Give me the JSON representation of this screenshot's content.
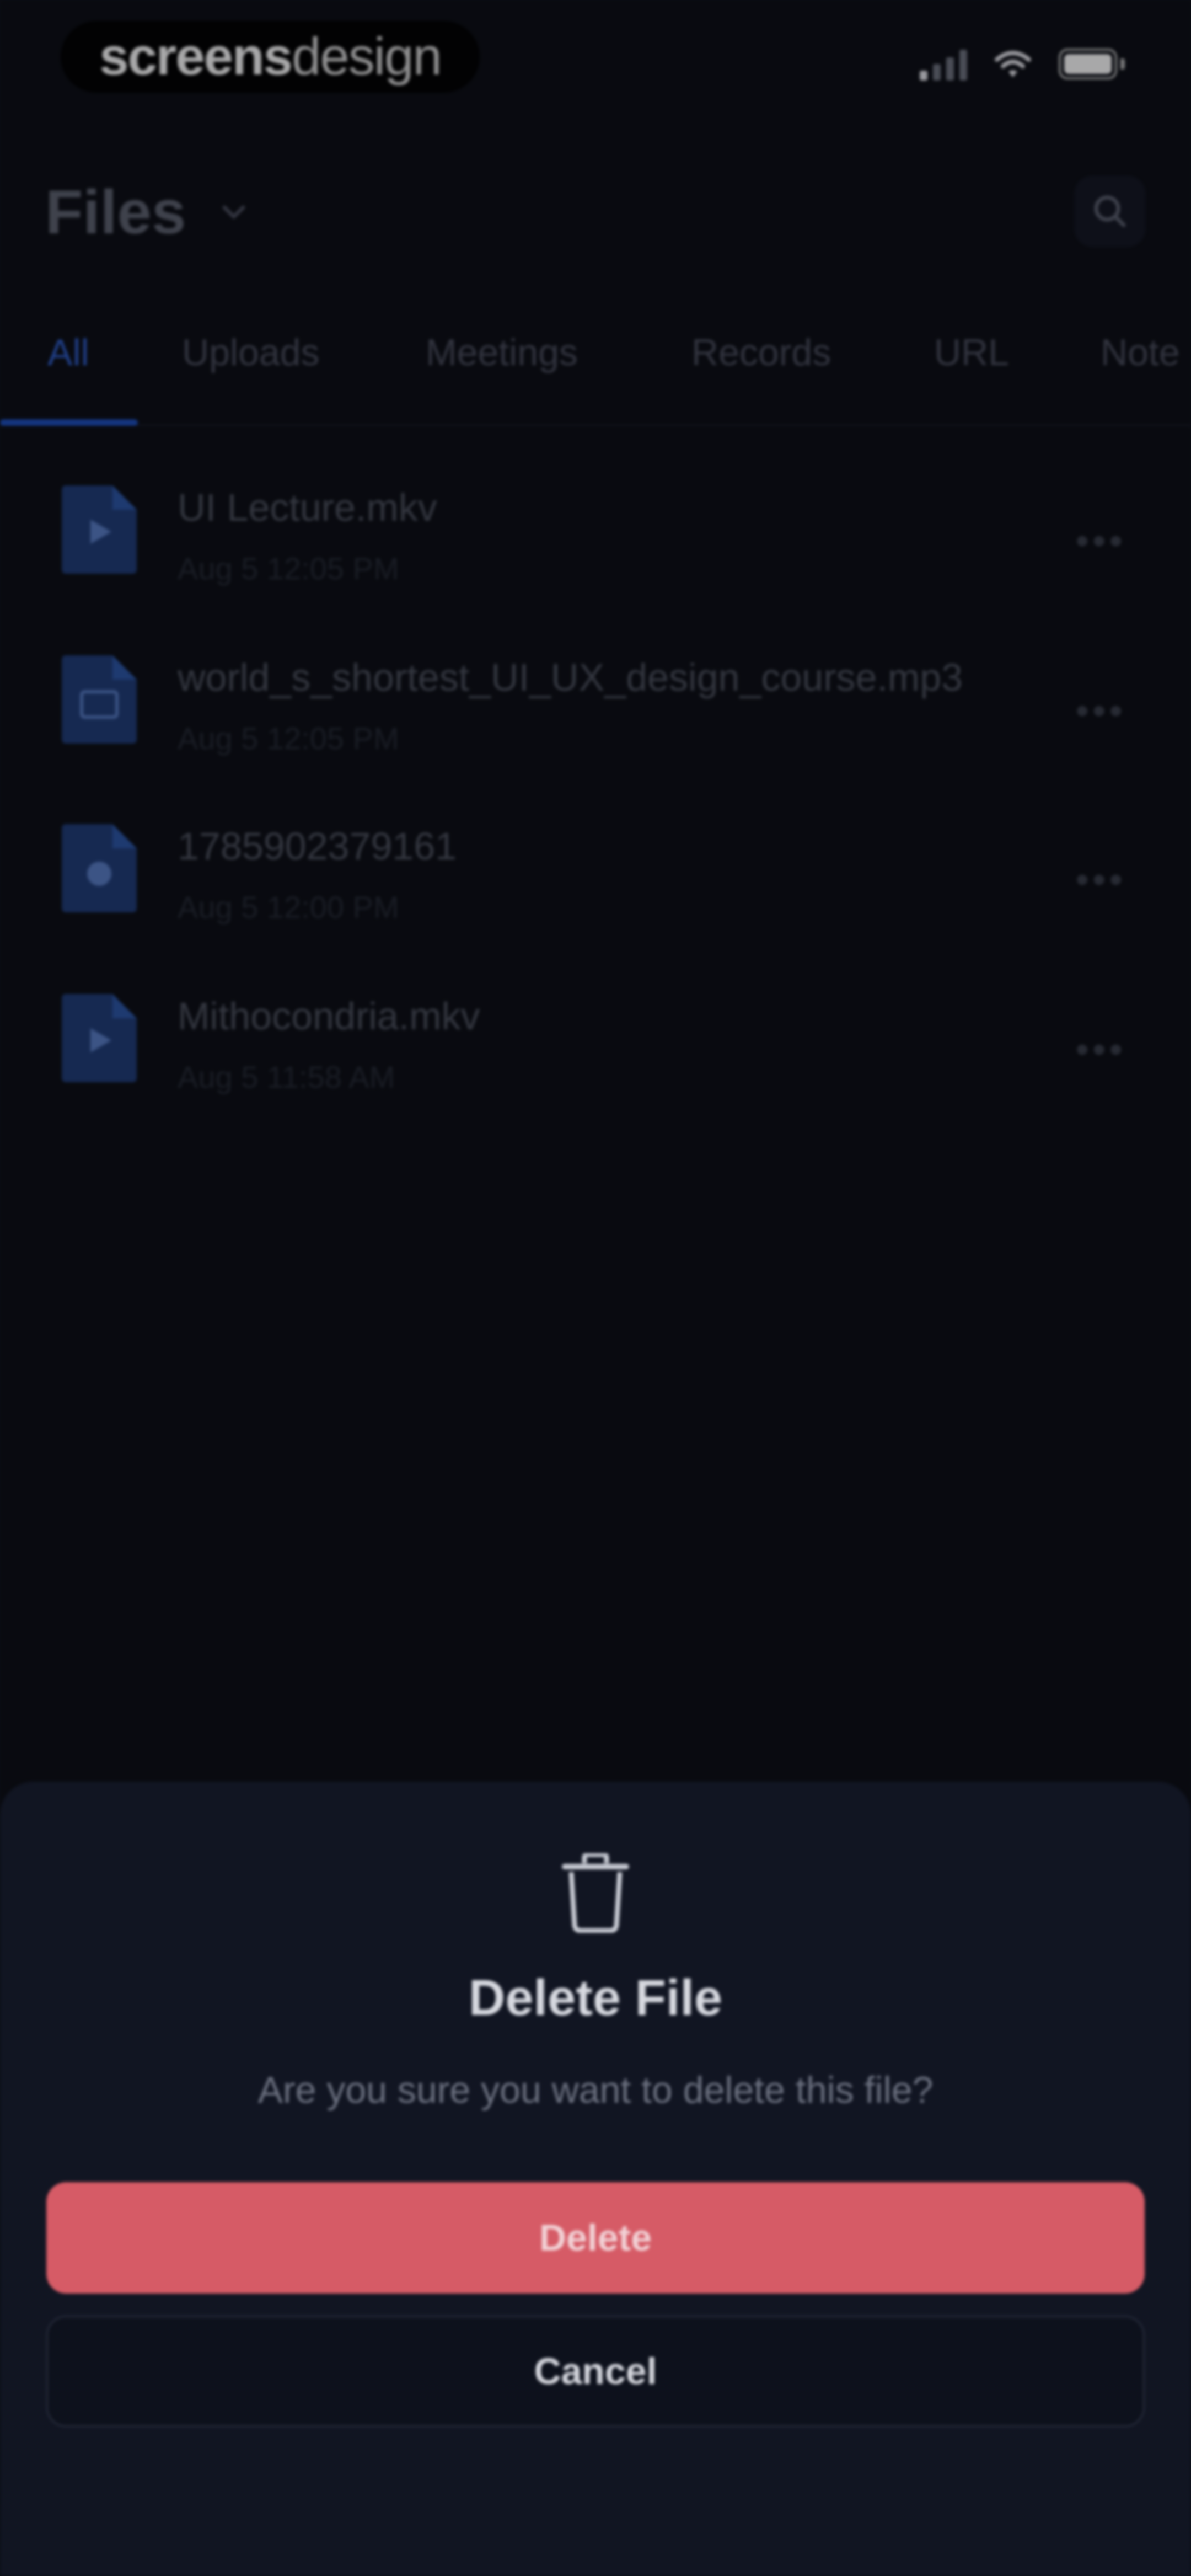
{
  "status_bar": {
    "brand_bold": "screens",
    "brand_light": "design"
  },
  "header": {
    "title": "Files",
    "icons": {
      "dropdown": "chevron-down-icon",
      "search": "search-icon"
    }
  },
  "tabs": [
    {
      "label": "All",
      "active": true
    },
    {
      "label": "Uploads",
      "active": false
    },
    {
      "label": "Meetings",
      "active": false
    },
    {
      "label": "Records",
      "active": false
    },
    {
      "label": "URL",
      "active": false
    },
    {
      "label": "Note",
      "active": false
    }
  ],
  "files": [
    {
      "name": "UI Lecture.mkv",
      "date": "Aug 5 12:05 PM",
      "icon": "video-file-icon"
    },
    {
      "name": "world_s_shortest_UI_UX_design_course.mp3",
      "date": "Aug 5 12:05 PM",
      "icon": "audio-file-icon"
    },
    {
      "name": "1785902379161",
      "date": "Aug 5 12:00 PM",
      "icon": "record-file-icon"
    },
    {
      "name": "Mithocondria.mkv",
      "date": "Aug 5 11:58 AM",
      "icon": "video-file-icon"
    }
  ],
  "dialog": {
    "title": "Delete File",
    "message": "Are you sure you want to delete this file?",
    "delete_label": "Delete",
    "cancel_label": "Cancel",
    "icon": "trash-icon"
  },
  "colors": {
    "background": "#0b0d14",
    "sheet": "#111522",
    "accent": "#1d4fbf",
    "danger": "#d65b66"
  }
}
